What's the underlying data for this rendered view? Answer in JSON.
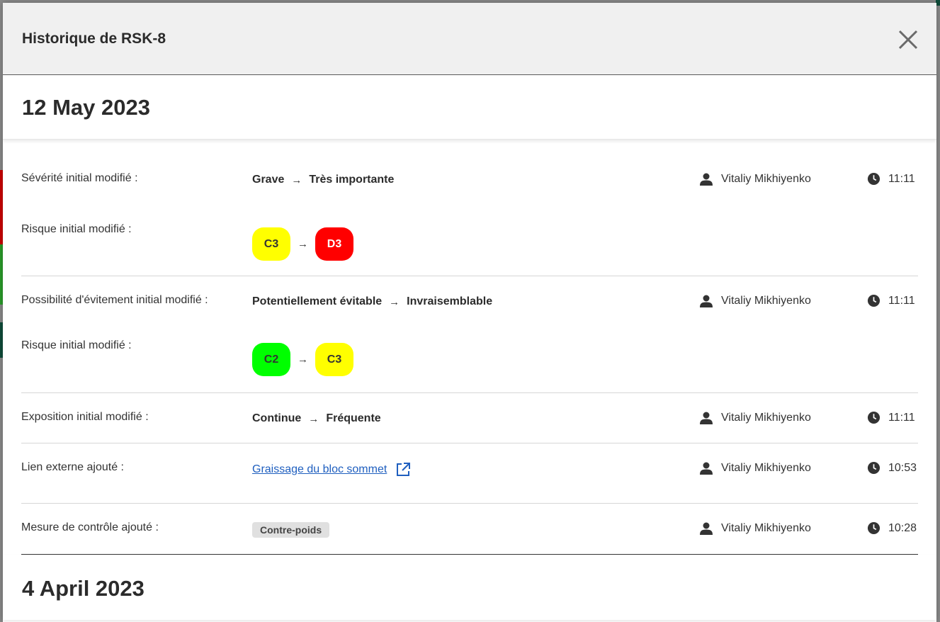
{
  "modal": {
    "title": "Historique de RSK-8"
  },
  "groups": [
    {
      "date": "12 May 2023",
      "entries": [
        {
          "rows": [
            {
              "label": "Sévérité initial modifié :",
              "from": "Grave",
              "to": "Très importante"
            },
            {
              "label": "Risque initial modifié :",
              "from_badge": "C3",
              "to_badge": "D3"
            }
          ],
          "user": "Vitaliy Mikhiyenko",
          "time": "11:11"
        },
        {
          "rows": [
            {
              "label": "Possibilité d'évitement initial modifié :",
              "from": "Potentiellement évitable",
              "to": "Invraisemblable"
            },
            {
              "label": "Risque initial modifié :",
              "from_badge": "C2",
              "to_badge": "C3"
            }
          ],
          "user": "Vitaliy Mikhiyenko",
          "time": "11:11"
        },
        {
          "rows": [
            {
              "label": "Exposition initial modifié :",
              "from": "Continue",
              "to": "Fréquente"
            }
          ],
          "user": "Vitaliy Mikhiyenko",
          "time": "11:11"
        },
        {
          "rows": [
            {
              "label": "Lien externe ajouté :",
              "link": "Graissage du bloc sommet"
            }
          ],
          "user": "Vitaliy Mikhiyenko",
          "time": "10:53"
        },
        {
          "rows": [
            {
              "label": "Mesure de contrôle ajouté :",
              "tag": "Contre-poids"
            }
          ],
          "user": "Vitaliy Mikhiyenko",
          "time": "10:28"
        }
      ]
    },
    {
      "date": "4 April 2023"
    }
  ],
  "arrow_glyph": "→",
  "colors": {
    "yellow": "#ffff00",
    "red": "#ff0000",
    "green": "#00ff00",
    "link": "#1f5fbf"
  },
  "icons": {
    "user": "person-icon",
    "time": "clock-icon",
    "external": "external-link-icon",
    "close": "close-icon"
  }
}
